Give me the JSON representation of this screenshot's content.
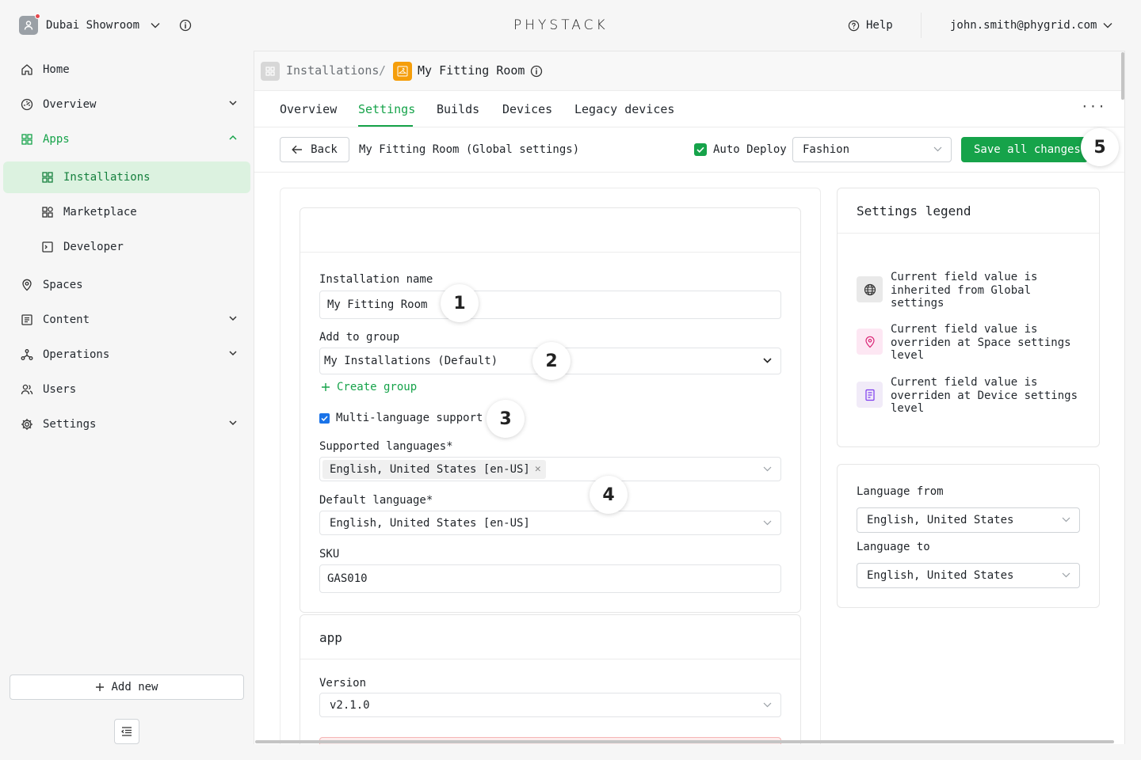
{
  "header": {
    "org_name": "Dubai Showroom",
    "brand": "PHYSTACK",
    "help_label": "Help",
    "user_email": "john.smith@phygrid.com"
  },
  "sidebar": {
    "items": {
      "home": "Home",
      "overview": "Overview",
      "apps": "Apps",
      "installations": "Installations",
      "marketplace": "Marketplace",
      "developer": "Developer",
      "spaces": "Spaces",
      "content": "Content",
      "operations": "Operations",
      "users": "Users",
      "settings": "Settings"
    },
    "add_new_label": "Add new"
  },
  "breadcrumb": {
    "parent": "Installations",
    "separator": "/",
    "current": "My Fitting Room"
  },
  "tabs": [
    "Overview",
    "Settings",
    "Builds",
    "Devices",
    "Legacy devices"
  ],
  "active_tab": "Settings",
  "more_label": "···",
  "toolbar": {
    "back_label": "Back",
    "title": "My Fitting Room (Global settings)",
    "auto_deploy_label": "Auto Deploy",
    "auto_deploy_checked": true,
    "env_value": "Fashion",
    "save_label": "Save all changes"
  },
  "markers": [
    "1",
    "2",
    "3",
    "4",
    "5"
  ],
  "form": {
    "installation_name_label": "Installation name",
    "installation_name_value": "My Fitting Room",
    "group_label": "Add to group",
    "group_value": "My Installations (Default)",
    "create_group_label": "Create group",
    "multi_language_label": "Multi-language support",
    "multi_language_checked": true,
    "supported_languages_label": "Supported languages*",
    "supported_languages": [
      "English, United States [en-US]"
    ],
    "default_language_label": "Default language*",
    "default_language_value": "English, United States [en-US]",
    "sku_label": "SKU",
    "sku_value": "GAS010",
    "app_section_title": "app",
    "version_label": "Version",
    "version_value": "v2.1.0"
  },
  "legend": {
    "title": "Settings legend",
    "items": [
      {
        "icon": "globe-icon",
        "text": "Current field value is inherited from Global settings",
        "color": "#e9e9e9"
      },
      {
        "icon": "location-pin-icon",
        "text": "Current field value is overriden at Space settings level",
        "color": "#fde7f3"
      },
      {
        "icon": "device-icon",
        "text": "Current field value is overriden at Device settings level",
        "color": "#f1ebf8"
      }
    ]
  },
  "language_preview": {
    "from_label": "Language from",
    "from_value": "English, United States",
    "to_label": "Language to",
    "to_value": "English, United States"
  },
  "colors": {
    "accent": "#16a34a",
    "active_bg": "#dcf2e0",
    "checkbox_blue": "#1a73e8"
  }
}
